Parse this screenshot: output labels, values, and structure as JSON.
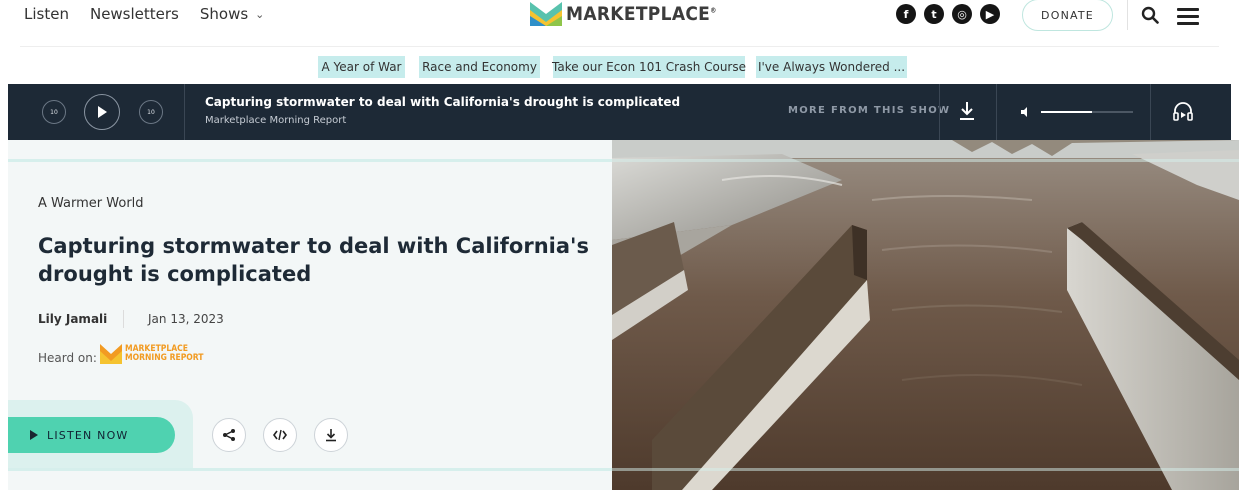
{
  "nav": {
    "links": [
      "Listen",
      "Newsletters",
      "Shows"
    ],
    "logo_text": "MARKETPLACE",
    "logo_mark": "®",
    "socials": [
      {
        "icon": "facebook-icon",
        "glyph": "f"
      },
      {
        "icon": "twitter-icon",
        "glyph": "t"
      },
      {
        "icon": "instagram-icon",
        "glyph": "◎"
      },
      {
        "icon": "youtube-icon",
        "glyph": "▶"
      }
    ],
    "donate": "DONATE"
  },
  "tags": [
    "A Year of War",
    "Race and Economy",
    "Take our Econ 101 Crash Course",
    "I've Always Wondered ..."
  ],
  "player": {
    "rewind_label": "10",
    "forward_label": "10",
    "title": "Capturing stormwater to deal with California's drought is complicated",
    "show": "Marketplace Morning Report",
    "more": "MORE FROM THIS SHOW",
    "volume": 0.55
  },
  "article": {
    "kicker": "A Warmer World",
    "headline": "Capturing stormwater to deal with California's drought is complicated",
    "author": "Lily Jamali",
    "date": "Jan 13, 2023",
    "heard_on": "Heard on:",
    "show_logo_line1": "MARKETPLACE",
    "show_logo_line2": "MORNING REPORT",
    "listen_now": "LISTEN NOW"
  },
  "colors": {
    "player_bg": "#1d2936",
    "accent_green": "#4fd2b0",
    "tag_bg": "#c6ecec",
    "hero_bg": "#f3f7f7"
  }
}
